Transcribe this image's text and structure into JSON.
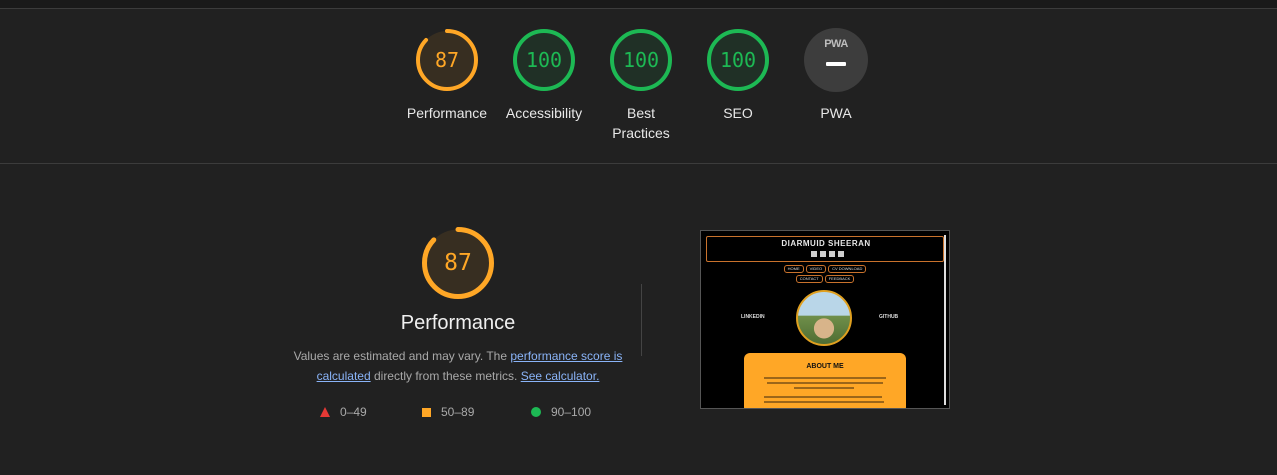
{
  "summary_gauges": [
    {
      "label": "Performance",
      "score": 87,
      "score_text": "87",
      "color": "#ffa726"
    },
    {
      "label": "Accessibility",
      "score": 100,
      "score_text": "100",
      "color": "#1db954"
    },
    {
      "label": "Best Practices",
      "score": 100,
      "score_text": "100",
      "color": "#1db954"
    },
    {
      "label": "SEO",
      "score": 100,
      "score_text": "100",
      "color": "#1db954"
    }
  ],
  "pwa": {
    "badge_text": "PWA",
    "label": "PWA"
  },
  "performance": {
    "score": 87,
    "score_text": "87",
    "title": "Performance",
    "desc_prefix": "Values are estimated and may vary. The ",
    "desc_link1": "performance score is calculated",
    "desc_mid": " directly from these metrics. ",
    "desc_link2": "See calculator.",
    "color": "#ffa726"
  },
  "legend": [
    {
      "icon": "triangle-icon",
      "range": "0–49",
      "color": "#e53935"
    },
    {
      "icon": "square-icon",
      "range": "50–89",
      "color": "#ffa726"
    },
    {
      "icon": "circle-icon",
      "range": "90–100",
      "color": "#1db954"
    }
  ],
  "screenshot": {
    "site_name": "DIARMUID SHEERAN",
    "nav_row1": [
      "HOME",
      "VIDEO",
      "CV DOWNLOAD"
    ],
    "nav_row2": [
      "CONTACT",
      "FEEDBACK"
    ],
    "left_link": "LINKEDIN",
    "right_link": "GITHUB",
    "section_title": "ABOUT ME"
  }
}
